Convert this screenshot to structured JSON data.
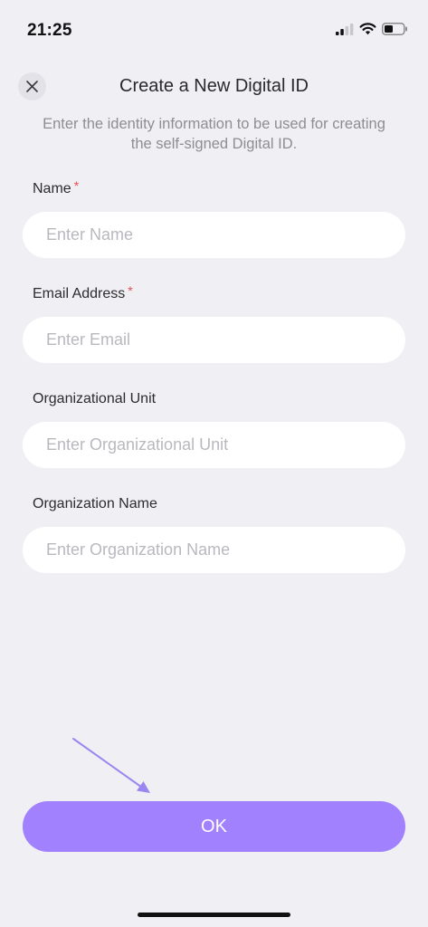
{
  "status_bar": {
    "time": "21:25"
  },
  "header": {
    "title": "Create a New Digital ID",
    "close_icon": "close-icon"
  },
  "description": "Enter the identity information to be used for creating the self-signed Digital ID.",
  "required_marker": "*",
  "fields": [
    {
      "label": "Name",
      "required": true,
      "placeholder": "Enter Name",
      "value": ""
    },
    {
      "label": "Email Address",
      "required": true,
      "placeholder": "Enter Email",
      "value": ""
    },
    {
      "label": "Organizational Unit",
      "required": false,
      "placeholder": "Enter Organizational Unit",
      "value": ""
    },
    {
      "label": "Organization Name",
      "required": false,
      "placeholder": "Enter Organization Name",
      "value": ""
    }
  ],
  "ok_button": {
    "label": "OK"
  },
  "colors": {
    "background": "#f0eff4",
    "accent": "#a181fd",
    "required": "#ef4b4b",
    "arrow": "#9b86f0"
  },
  "icons": [
    "cellular-signal-icon",
    "wifi-icon",
    "battery-icon",
    "close-icon",
    "annotation-arrow-icon"
  ]
}
